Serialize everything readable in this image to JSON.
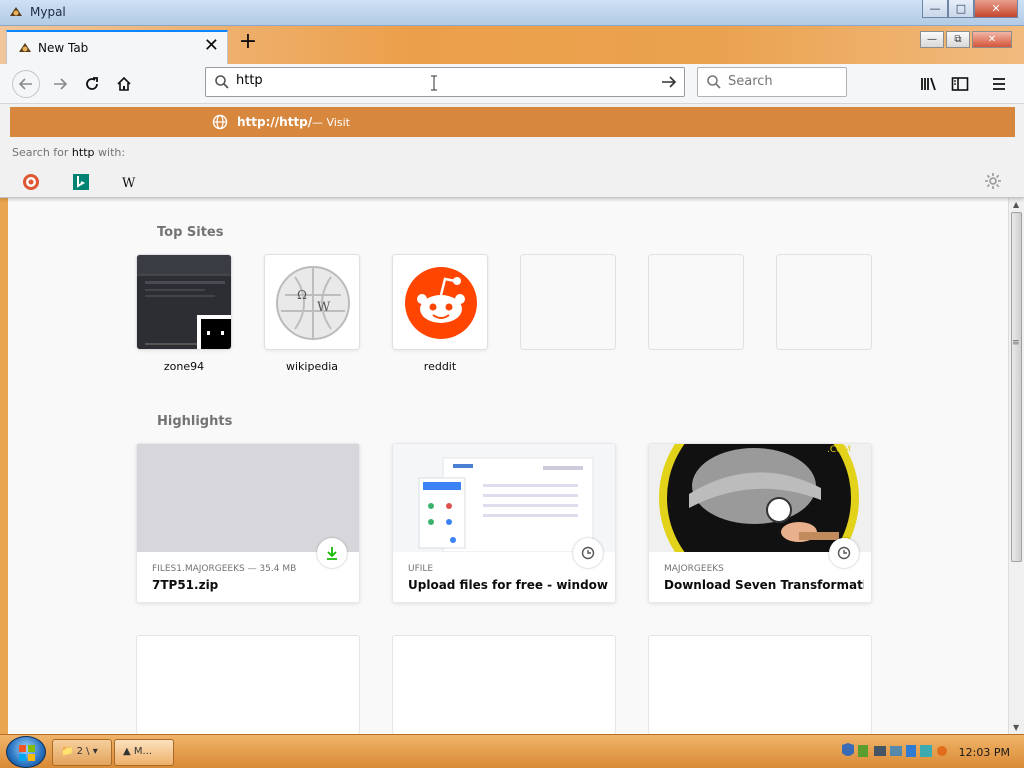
{
  "window": {
    "title": "Mypal"
  },
  "tab": {
    "label": "New Tab"
  },
  "urlbar": {
    "value": "http"
  },
  "searchbar": {
    "placeholder": "Search"
  },
  "suggestion": {
    "url": "http://http/",
    "dash": "—",
    "action": "Visit"
  },
  "search_with": {
    "prefix": "Search for ",
    "term": "http",
    "suffix": " with:"
  },
  "engines": [
    "duckduckgo-icon",
    "bing-icon",
    "wikipedia-icon"
  ],
  "top_sites": {
    "title": "Top Sites",
    "items": [
      {
        "label": "zone94"
      },
      {
        "label": "wikipedia"
      },
      {
        "label": "reddit"
      }
    ]
  },
  "highlights": {
    "title": "Highlights",
    "cards": [
      {
        "source": "FILES1.MAJORGEEKS — 35.4 MB",
        "title": "7TP51.zip",
        "badge": "download-icon"
      },
      {
        "source": "UFILE",
        "title": "Upload files for free - windows ...",
        "badge": "clock-icon"
      },
      {
        "source": "MAJORGEEKS",
        "title": "Download Seven Transformatio...",
        "badge": "clock-icon"
      }
    ]
  },
  "taskbar": {
    "tasks": [
      "2 \\",
      "M..."
    ],
    "clock": "12:03 PM"
  },
  "colors": {
    "accent": "#0a84ff",
    "suggest": "#d7883e",
    "theme": "#e9a54f"
  }
}
